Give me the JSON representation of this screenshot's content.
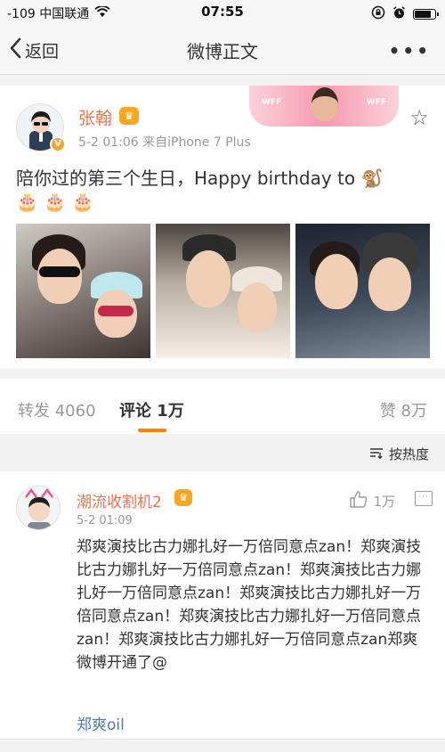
{
  "status_bar": {
    "carrier": "-109 中国联通",
    "time": "07:55",
    "battery_level": 0.9
  },
  "nav": {
    "back_label": "返回",
    "title": "微博正文",
    "more_label": "•••"
  },
  "post": {
    "author": "张翰",
    "verified_badge": "V",
    "crown_icon": "crown-icon",
    "timestamp": "5-2 01:06",
    "source": "来自iPhone 7 Plus",
    "banner_tag_left": "WFF",
    "banner_tag_right": "WFF",
    "text": "陪你过的第三个生日，Happy birthday to 🐒",
    "emojis": "🎂 🎂 🎂",
    "photos": [
      "photo-1",
      "photo-2",
      "photo-3"
    ]
  },
  "tabs": {
    "repost": "转发 4060",
    "comment": "评论 1万",
    "like": "赞 8万"
  },
  "sort": {
    "label": "按热度"
  },
  "comment": {
    "author": "潮流收割机2",
    "timestamp": "5-2 01:09",
    "like_count": "1万",
    "text": "郑爽演技比古力娜扎好一万倍同意点zan！郑爽演技比古力娜扎好一万倍同意点zan！郑爽演技比古力娜扎好一万倍同意点zan！郑爽演技比古力娜扎好一万倍同意点zan！郑爽演技比古力娜扎好一万倍同意点zan！郑爽演技比古力娜扎好一万倍同意点zan郑爽微博开通了@",
    "mention": "郑爽oil"
  },
  "colors": {
    "accent_orange": "#ff8200",
    "name_orange": "#eb7350",
    "link_blue": "#507daf"
  }
}
